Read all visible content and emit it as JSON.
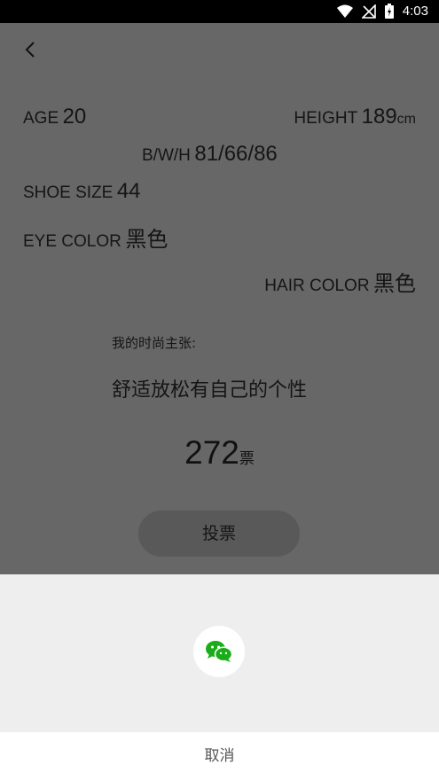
{
  "status": {
    "time": "4:03"
  },
  "profile": {
    "age_label": "AGE",
    "age": "20",
    "height_label": "HEIGHT",
    "height": "189",
    "height_unit": "cm",
    "bwh_label": "B/W/H",
    "bwh": "81/66/86",
    "shoe_label": "SHOE SIZE",
    "shoe": "44",
    "eye_label": "EYE COLOR",
    "eye": "黑色",
    "hair_label": "HAIR COLOR",
    "hair": "黑色"
  },
  "fashion": {
    "label": "我的时尚主张:",
    "text": "舒适放松有自己的个性"
  },
  "votes": {
    "count": "272",
    "unit": "票"
  },
  "vote_button": "投票",
  "share_sheet": {
    "cancel": "取消"
  },
  "colors": {
    "wechat": "#1aad19"
  }
}
